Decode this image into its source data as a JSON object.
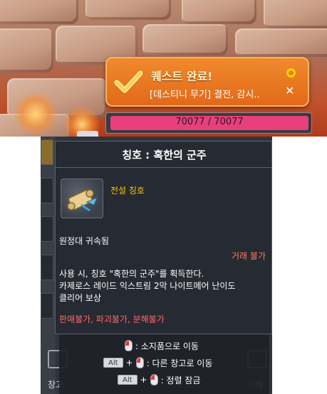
{
  "quest_notification": {
    "title": "퀘스트 완료!",
    "description": "[데스티니 무기] 결전, 감시..",
    "close_symbol": "✕",
    "icon": "checkmark-icon"
  },
  "status_bar": {
    "hp_text": "70077 / 70077",
    "hp_fraction": 1.0,
    "color": "#e8407a"
  },
  "tooltip": {
    "title": "칭호 : 혹한의 군주",
    "grade": "전설 칭호",
    "bound": "원정대 귀속됨",
    "trade": "거래 불가",
    "description_lines": [
      "사용 시, 칭호 \"혹한의 군주\"를 획득한다.",
      "카제로스 레이드 익스트림 2막 나이트메어 난이도",
      "클리어 보상"
    ],
    "limits": "판매불가, 파괴불가, 분해불가",
    "item_icon": "scroll-icon",
    "grade_color": "#ffc400",
    "limit_color": "#ff6a6a"
  },
  "hints": [
    {
      "keys": [],
      "mouse": true,
      "text": ": 소지품으로 이동"
    },
    {
      "keys": [
        "Alt"
      ],
      "mouse": true,
      "text": ": 다른 창고로 이동"
    },
    {
      "keys": [
        "Alt"
      ],
      "mouse": true,
      "text": ": 정렬 잠금"
    }
  ],
  "hint_plus": "+",
  "bottom_tabs": {
    "left_label": "창고",
    "right_label": "거래"
  }
}
